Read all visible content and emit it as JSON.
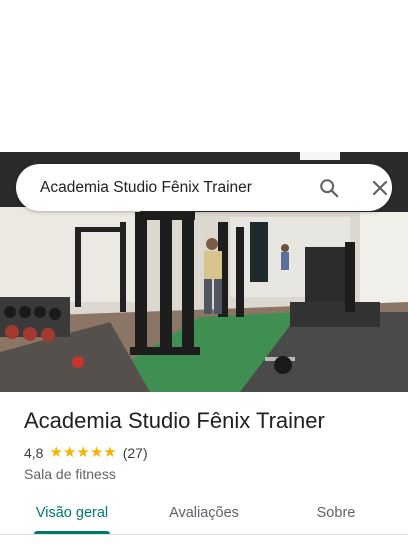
{
  "search": {
    "query": "Academia Studio Fênix Trainer",
    "search_icon": "search-icon",
    "close_icon": "close-icon"
  },
  "place": {
    "title": "Academia Studio Fênix Trainer",
    "rating": "4,8",
    "stars": [
      "★",
      "★",
      "★",
      "★",
      "★"
    ],
    "star_rating_value": 4.8,
    "reviews": "(27)",
    "category": "Sala de fitness"
  },
  "tabs": [
    {
      "label": "Visão geral",
      "active": true
    },
    {
      "label": "Avaliações",
      "active": false
    },
    {
      "label": "Sobre",
      "active": false
    }
  ],
  "colors": {
    "accent": "#00796b",
    "star": "#f4b400",
    "text": "#202124"
  }
}
